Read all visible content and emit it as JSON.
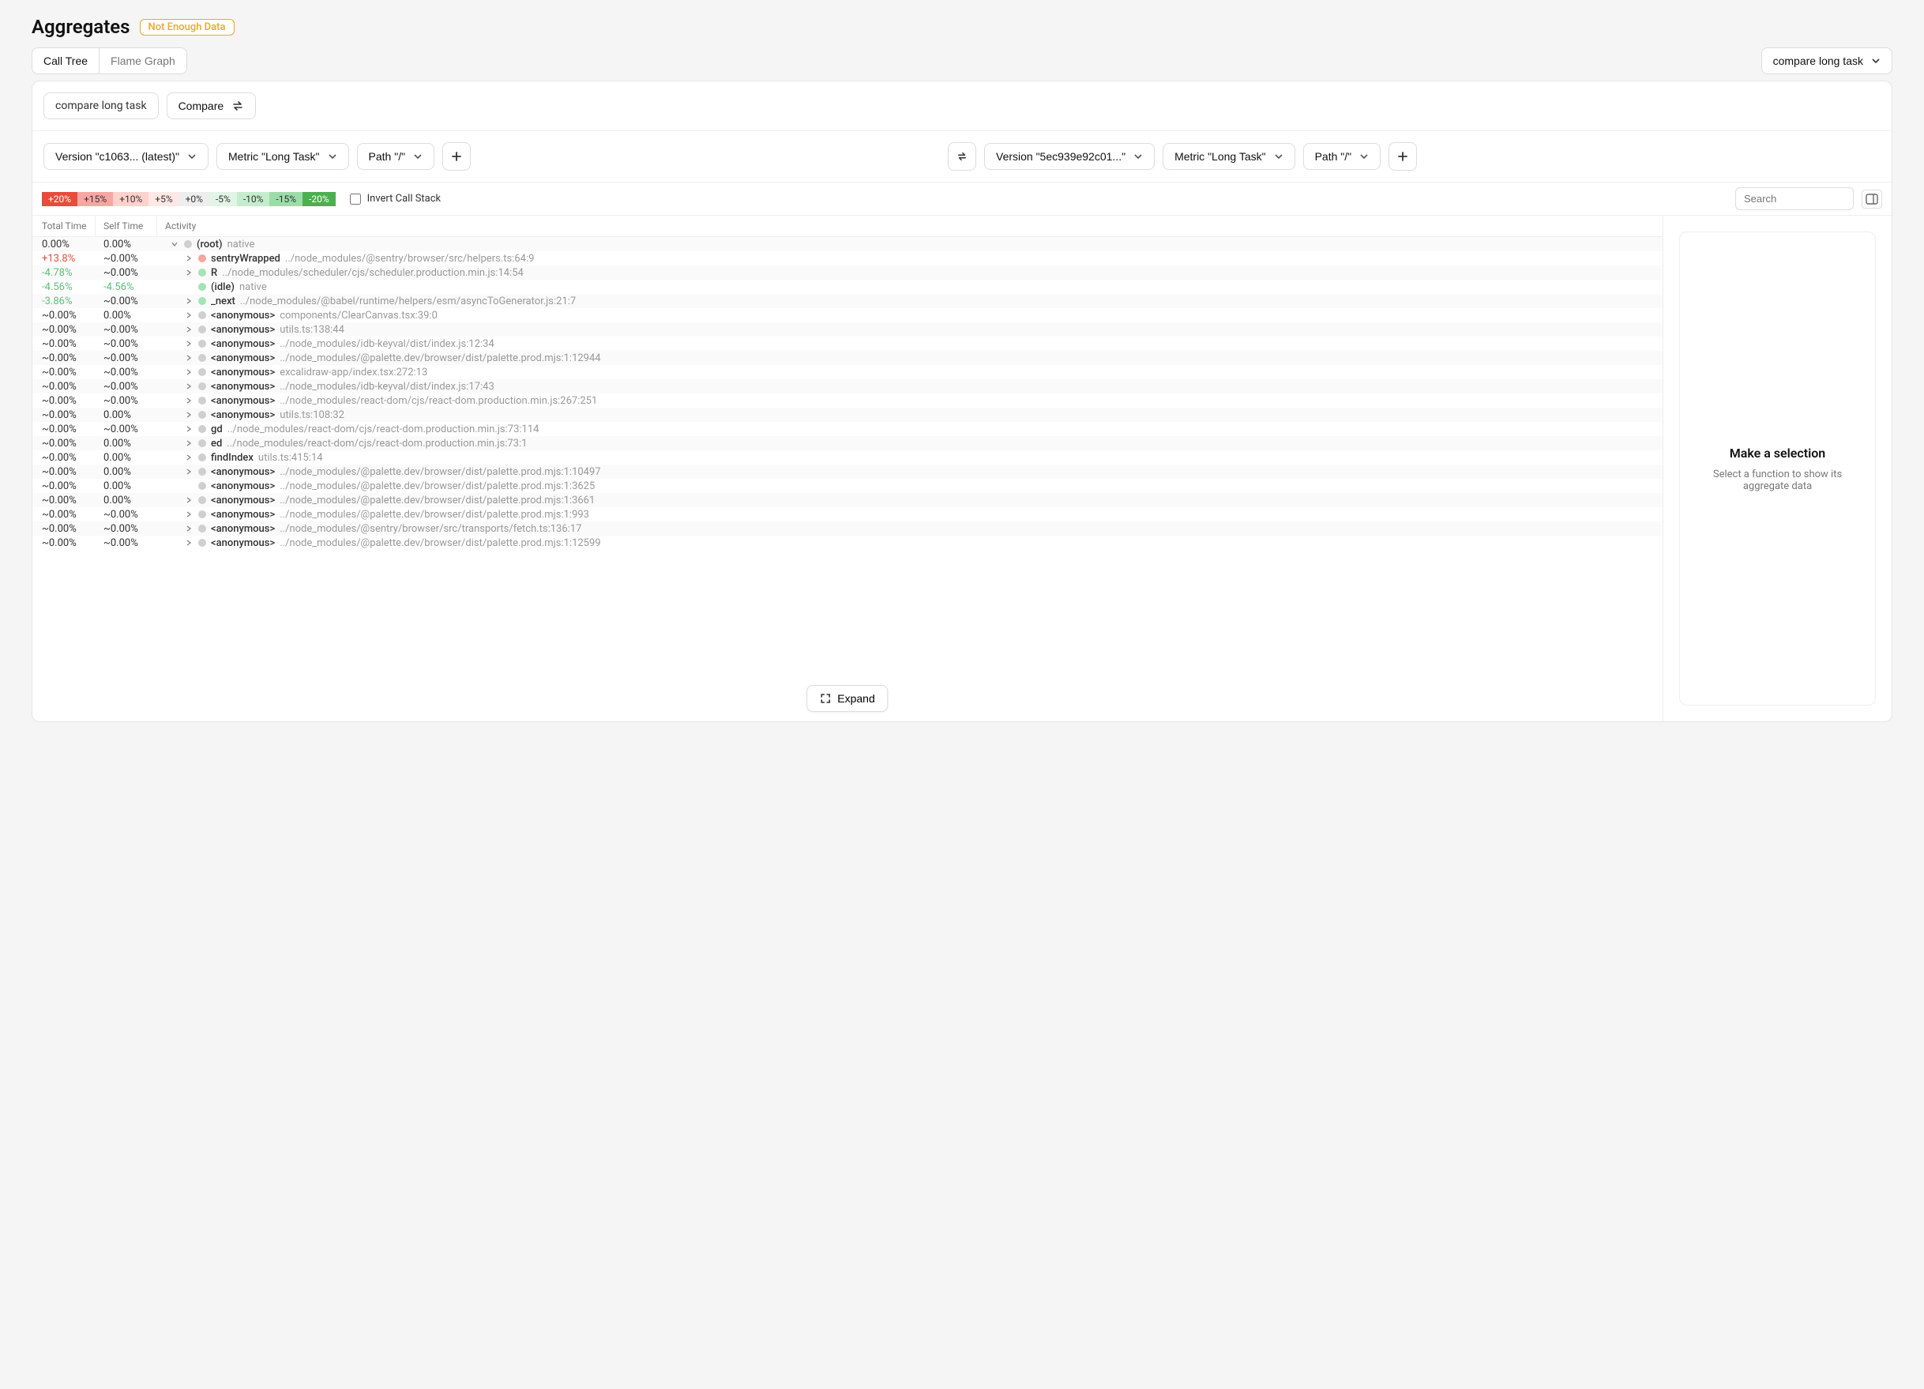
{
  "header": {
    "title": "Aggregates",
    "badge": "Not Enough Data"
  },
  "tabs": {
    "call_tree": "Call Tree",
    "flame_graph": "Flame Graph"
  },
  "top_dropdown": "compare long task",
  "compare_bar": {
    "label": "compare long task",
    "button": "Compare"
  },
  "left_selectors": {
    "version": "Version \"c1063...  (latest)\"",
    "metric": "Metric \"Long Task\"",
    "path": "Path \"/\""
  },
  "right_selectors": {
    "version": "Version \"5ec939e92c01...\"",
    "metric": "Metric \"Long Task\"",
    "path": "Path \"/\""
  },
  "legend": [
    "+20%",
    "+15%",
    "+10%",
    "+5%",
    "+0%",
    "-5%",
    "-10%",
    "-15%",
    "-20%"
  ],
  "invert_label": "Invert Call Stack",
  "search_placeholder": "Search",
  "columns": {
    "total": "Total Time",
    "self": "Self Time",
    "activity": "Activity"
  },
  "detail": {
    "title": "Make a selection",
    "sub": "Select a function to show its aggregate data"
  },
  "expand_label": "Expand",
  "rows": [
    {
      "total": "0.00%",
      "total_cls": "",
      "self": "0.00%",
      "self_cls": "",
      "indent": 0,
      "exp": "down",
      "marker": "gray",
      "fn": "(root)",
      "path": "native"
    },
    {
      "total": "+13.8%",
      "total_cls": "txt-red",
      "self": "~0.00%",
      "self_cls": "",
      "indent": 1,
      "exp": "right",
      "marker": "red",
      "fn": "sentryWrapped",
      "path": "../node_modules/@sentry/browser/src/helpers.ts:64:9"
    },
    {
      "total": "-4.78%",
      "total_cls": "txt-green",
      "self": "~0.00%",
      "self_cls": "",
      "indent": 1,
      "exp": "right",
      "marker": "green",
      "fn": "R",
      "path": "../node_modules/scheduler/cjs/scheduler.production.min.js:14:54"
    },
    {
      "total": "-4.56%",
      "total_cls": "txt-green",
      "self": "-4.56%",
      "self_cls": "txt-green",
      "indent": 1,
      "exp": "none",
      "marker": "green",
      "fn": "(idle)",
      "path": "native"
    },
    {
      "total": "-3.86%",
      "total_cls": "txt-green",
      "self": "~0.00%",
      "self_cls": "",
      "indent": 1,
      "exp": "right",
      "marker": "green",
      "fn": "_next",
      "path": "../node_modules/@babel/runtime/helpers/esm/asyncToGenerator.js:21:7"
    },
    {
      "total": "~0.00%",
      "total_cls": "",
      "self": "0.00%",
      "self_cls": "",
      "indent": 1,
      "exp": "right",
      "marker": "gray",
      "fn": "<anonymous>",
      "path": "components/ClearCanvas.tsx:39:0"
    },
    {
      "total": "~0.00%",
      "total_cls": "",
      "self": "~0.00%",
      "self_cls": "",
      "indent": 1,
      "exp": "right",
      "marker": "gray",
      "fn": "<anonymous>",
      "path": "utils.ts:138:44"
    },
    {
      "total": "~0.00%",
      "total_cls": "",
      "self": "~0.00%",
      "self_cls": "",
      "indent": 1,
      "exp": "right",
      "marker": "gray",
      "fn": "<anonymous>",
      "path": "../node_modules/idb-keyval/dist/index.js:12:34"
    },
    {
      "total": "~0.00%",
      "total_cls": "",
      "self": "~0.00%",
      "self_cls": "",
      "indent": 1,
      "exp": "right",
      "marker": "gray",
      "fn": "<anonymous>",
      "path": "../node_modules/@palette.dev/browser/dist/palette.prod.mjs:1:12944"
    },
    {
      "total": "~0.00%",
      "total_cls": "",
      "self": "~0.00%",
      "self_cls": "",
      "indent": 1,
      "exp": "right",
      "marker": "gray",
      "fn": "<anonymous>",
      "path": "excalidraw-app/index.tsx:272:13"
    },
    {
      "total": "~0.00%",
      "total_cls": "",
      "self": "~0.00%",
      "self_cls": "",
      "indent": 1,
      "exp": "right",
      "marker": "gray",
      "fn": "<anonymous>",
      "path": "../node_modules/idb-keyval/dist/index.js:17:43"
    },
    {
      "total": "~0.00%",
      "total_cls": "",
      "self": "~0.00%",
      "self_cls": "",
      "indent": 1,
      "exp": "right",
      "marker": "gray",
      "fn": "<anonymous>",
      "path": "../node_modules/react-dom/cjs/react-dom.production.min.js:267:251"
    },
    {
      "total": "~0.00%",
      "total_cls": "",
      "self": "0.00%",
      "self_cls": "",
      "indent": 1,
      "exp": "right",
      "marker": "gray",
      "fn": "<anonymous>",
      "path": "utils.ts:108:32"
    },
    {
      "total": "~0.00%",
      "total_cls": "",
      "self": "~0.00%",
      "self_cls": "",
      "indent": 1,
      "exp": "right",
      "marker": "gray",
      "fn": "gd",
      "path": "../node_modules/react-dom/cjs/react-dom.production.min.js:73:114"
    },
    {
      "total": "~0.00%",
      "total_cls": "",
      "self": "0.00%",
      "self_cls": "",
      "indent": 1,
      "exp": "right",
      "marker": "gray",
      "fn": "ed",
      "path": "../node_modules/react-dom/cjs/react-dom.production.min.js:73:1"
    },
    {
      "total": "~0.00%",
      "total_cls": "",
      "self": "0.00%",
      "self_cls": "",
      "indent": 1,
      "exp": "right",
      "marker": "gray",
      "fn": "findIndex",
      "path": "utils.ts:415:14"
    },
    {
      "total": "~0.00%",
      "total_cls": "",
      "self": "0.00%",
      "self_cls": "",
      "indent": 1,
      "exp": "right",
      "marker": "gray",
      "fn": "<anonymous>",
      "path": "../node_modules/@palette.dev/browser/dist/palette.prod.mjs:1:10497"
    },
    {
      "total": "~0.00%",
      "total_cls": "",
      "self": "0.00%",
      "self_cls": "",
      "indent": 1,
      "exp": "none",
      "marker": "gray",
      "fn": "<anonymous>",
      "path": "../node_modules/@palette.dev/browser/dist/palette.prod.mjs:1:3625"
    },
    {
      "total": "~0.00%",
      "total_cls": "",
      "self": "0.00%",
      "self_cls": "",
      "indent": 1,
      "exp": "right",
      "marker": "gray",
      "fn": "<anonymous>",
      "path": "../node_modules/@palette.dev/browser/dist/palette.prod.mjs:1:3661"
    },
    {
      "total": "~0.00%",
      "total_cls": "",
      "self": "~0.00%",
      "self_cls": "",
      "indent": 1,
      "exp": "right",
      "marker": "gray",
      "fn": "<anonymous>",
      "path": "../node_modules/@palette.dev/browser/dist/palette.prod.mjs:1:993"
    },
    {
      "total": "~0.00%",
      "total_cls": "",
      "self": "~0.00%",
      "self_cls": "",
      "indent": 1,
      "exp": "right",
      "marker": "gray",
      "fn": "<anonymous>",
      "path": "../node_modules/@sentry/browser/src/transports/fetch.ts:136:17"
    },
    {
      "total": "~0.00%",
      "total_cls": "",
      "self": "~0.00%",
      "self_cls": "",
      "indent": 1,
      "exp": "right",
      "marker": "gray",
      "fn": "<anonymous>",
      "path": "../node_modules/@palette.dev/browser/dist/palette.prod.mjs:1:12599"
    }
  ]
}
